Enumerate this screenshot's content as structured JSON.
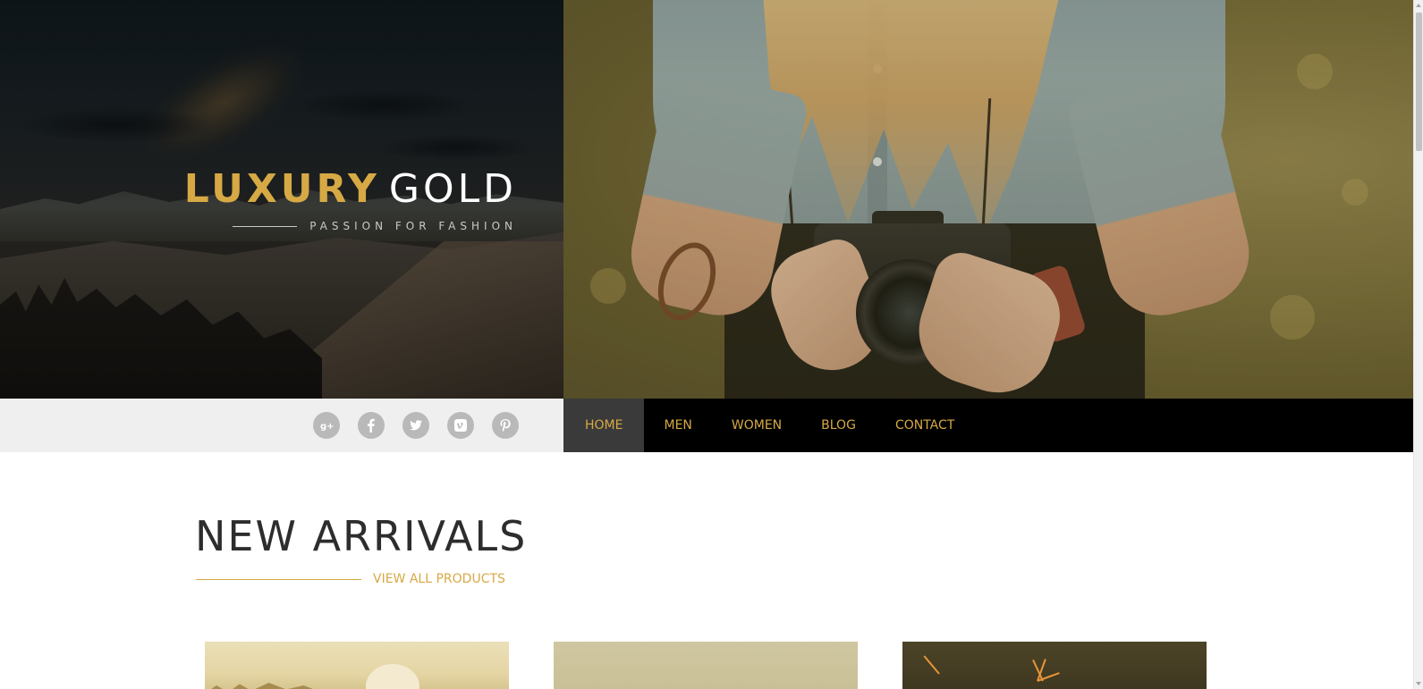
{
  "brand": {
    "title_part1": "LUXURY",
    "title_part2": "GOLD",
    "tagline": "PASSION FOR FASHION"
  },
  "colors": {
    "gold": "#d6a945",
    "nav_bg": "#000000",
    "nav_active_bg": "#3a3a3a",
    "social_bar_bg": "#efefef",
    "social_icon_bg": "#b9b9b9"
  },
  "social": [
    {
      "icon": "google-plus-icon"
    },
    {
      "icon": "facebook-icon"
    },
    {
      "icon": "twitter-icon"
    },
    {
      "icon": "vimeo-icon"
    },
    {
      "icon": "pinterest-icon"
    }
  ],
  "nav": {
    "items": [
      {
        "label": "HOME",
        "active": true
      },
      {
        "label": "MEN",
        "active": false
      },
      {
        "label": "WOMEN",
        "active": false
      },
      {
        "label": "BLOG",
        "active": false
      },
      {
        "label": "CONTACT",
        "active": false
      }
    ]
  },
  "new_arrivals": {
    "title": "NEW ARRIVALS",
    "view_all": "VIEW ALL PRODUCTS"
  }
}
